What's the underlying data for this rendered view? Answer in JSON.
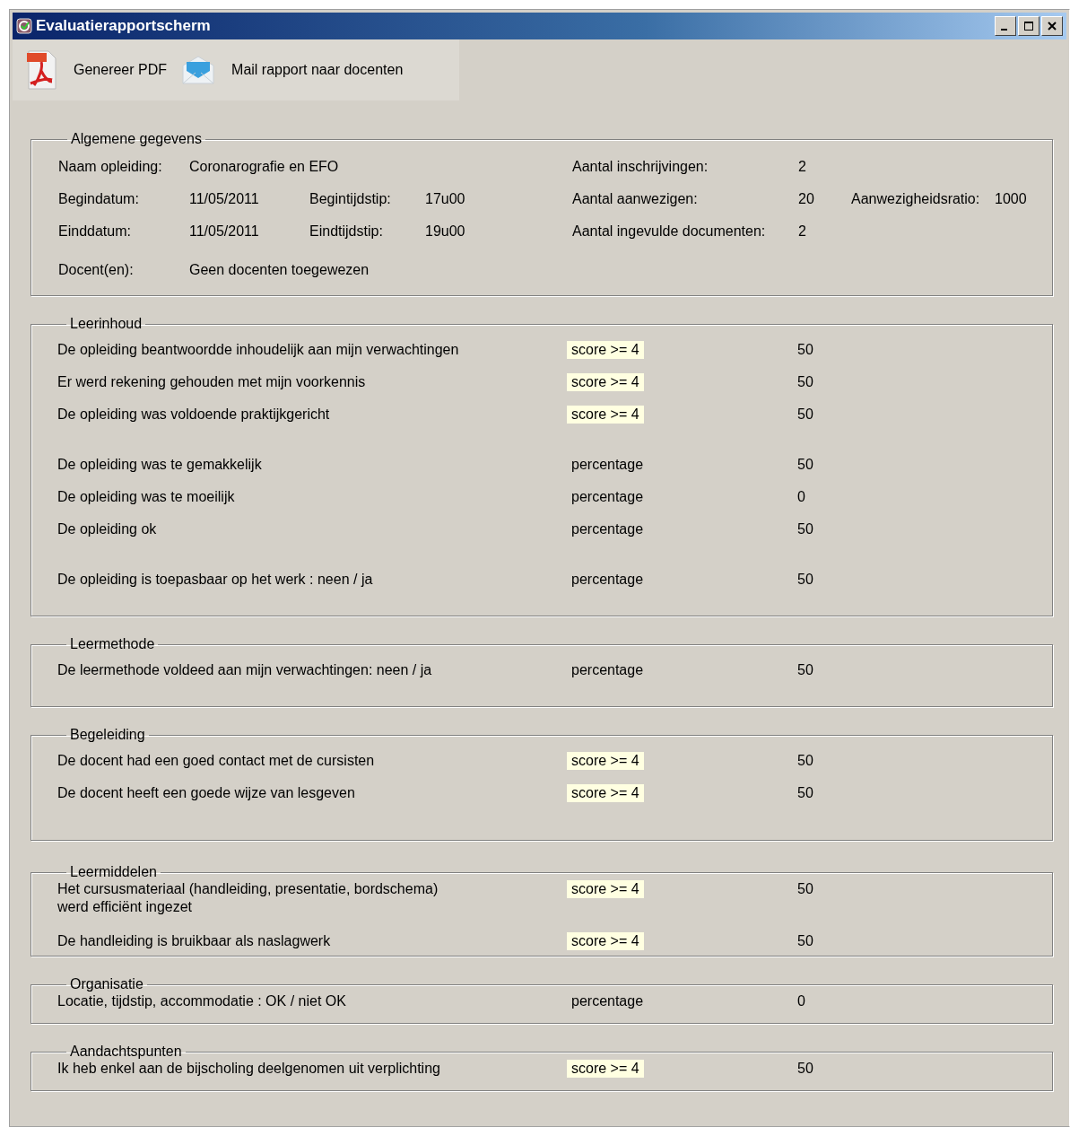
{
  "window": {
    "title": "Evaluatierapportscherm"
  },
  "toolbar": [
    {
      "kind": "pdf",
      "label": "Genereer PDF"
    },
    {
      "kind": "mail",
      "label": "Mail rapport naar docenten"
    }
  ],
  "general": {
    "legend": "Algemene gegevens",
    "course": [
      [
        {
          "label": "Naam opleiding:",
          "value": "Coronarografie en EFO"
        }
      ],
      [
        {
          "label": "Begindatum:",
          "value": "11/05/2011"
        },
        {
          "label": "Begintijdstip:",
          "value": "17u00"
        }
      ],
      [
        {
          "label": "Einddatum:",
          "value": "11/05/2011"
        },
        {
          "label": "Eindtijdstip:",
          "value": "19u00"
        }
      ],
      [
        {
          "label": "Docent(en):",
          "value": "Geen docenten toegewezen"
        }
      ]
    ],
    "attendance": [
      [
        {
          "label": "Aantal inschrijvingen:",
          "value": "2"
        }
      ],
      [
        {
          "label": "Aantal aanwezigen:",
          "value": "20"
        },
        {
          "label": "Aanwezigheidsratio:",
          "value": "1000"
        }
      ],
      [
        {
          "label": "Aantal ingevulde documenten:",
          "value": "2"
        }
      ]
    ]
  },
  "sections": [
    {
      "legend": "Leerinhoud",
      "groups": [
        [
          {
            "question": "De opleiding beantwoordde inhoudelijk aan mijn verwachtingen",
            "kind": "score",
            "measure": "score >= 4",
            "value": "50"
          },
          {
            "question": "Er werd rekening gehouden met mijn voorkennis",
            "kind": "score",
            "measure": "score >= 4",
            "value": "50"
          },
          {
            "question": "De opleiding was voldoende praktijkgericht",
            "kind": "score",
            "measure": "score >= 4",
            "value": "50"
          }
        ],
        [
          {
            "question": "De opleiding was te gemakkelijk",
            "kind": "percentage",
            "measure": "percentage",
            "value": "50"
          },
          {
            "question": "De opleiding was te moeilijk",
            "kind": "percentage",
            "measure": "percentage",
            "value": "0"
          },
          {
            "question": "De opleiding ok",
            "kind": "percentage",
            "measure": "percentage",
            "value": "50"
          }
        ],
        [
          {
            "question": "De opleiding is toepasbaar op het werk : neen / ja",
            "kind": "percentage",
            "measure": "percentage",
            "value": "50"
          }
        ]
      ]
    },
    {
      "legend": "Leermethode",
      "groups": [
        [
          {
            "question": "De leermethode voldeed aan mijn verwachtingen: neen / ja",
            "kind": "percentage",
            "measure": "percentage",
            "value": "50"
          }
        ]
      ]
    },
    {
      "legend": "Begeleiding",
      "groups": [
        [
          {
            "question": "De docent had een goed contact met de cursisten",
            "kind": "score",
            "measure": "score >= 4",
            "value": "50"
          },
          {
            "question": "De docent heeft een goede wijze van lesgeven",
            "kind": "score",
            "measure": "score >= 4",
            "value": "50"
          }
        ]
      ]
    },
    {
      "legend": "Leermiddelen",
      "groups": [
        [
          {
            "question": " Het cursusmateriaal (handleiding, presentatie, bordschema)\nwerd efficiënt ingezet",
            "kind": "score",
            "measure": "score >= 4",
            "value": "50"
          },
          {
            "question": " De handleiding is bruikbaar als naslagwerk",
            "kind": "score",
            "measure": "score >= 4",
            "value": "50"
          }
        ]
      ]
    },
    {
      "legend": "Organisatie",
      "groups": [
        [
          {
            "question": "Locatie, tijdstip, accommodatie : OK / niet OK",
            "kind": "percentage",
            "measure": "percentage",
            "value": "0"
          }
        ]
      ]
    },
    {
      "legend": "Aandachtspunten",
      "groups": [
        [
          {
            "question": "Ik heb enkel aan de bijscholing deelgenomen uit verplichting",
            "kind": "score",
            "measure": "score >= 4",
            "value": "50"
          }
        ]
      ]
    }
  ]
}
